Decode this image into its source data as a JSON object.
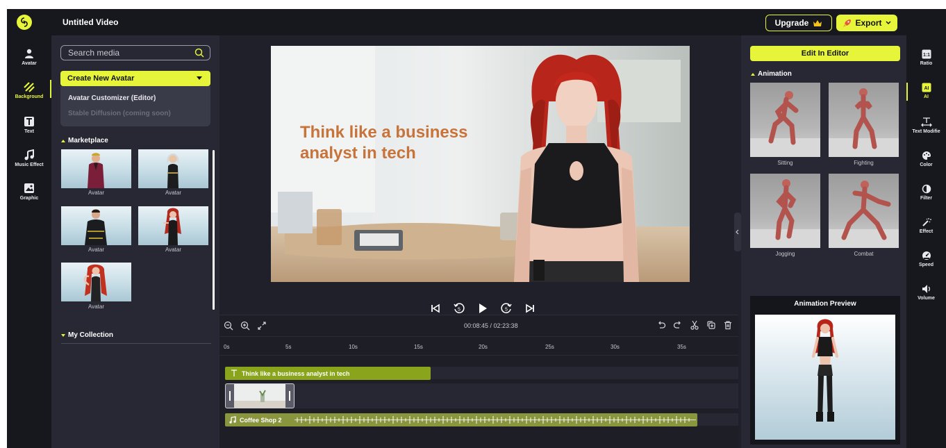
{
  "app": {
    "title": "Untitled Video",
    "upgrade_label": "Upgrade",
    "export_label": "Export",
    "accent_color": "#e6f53a"
  },
  "left_rail": {
    "items": [
      {
        "label": "Avatar",
        "icon": "person-icon"
      },
      {
        "label": "Background",
        "icon": "background-pattern-icon",
        "active": true
      },
      {
        "label": "Text",
        "icon": "text-icon"
      },
      {
        "label": "Music Effect",
        "icon": "music-note-icon"
      },
      {
        "label": "Graphic",
        "icon": "image-icon"
      }
    ]
  },
  "media": {
    "search_placeholder": "Search media",
    "create_button": "Create New Avatar",
    "dropdown": [
      {
        "label": "Avatar Customizer (Editor)",
        "enabled": true
      },
      {
        "label": "Stable Diffusion (coming soon)",
        "enabled": false
      }
    ],
    "marketplace_heading": "Marketplace",
    "marketplace_items": [
      {
        "label": "Avatar"
      },
      {
        "label": "Avatar"
      },
      {
        "label": "Avatar"
      },
      {
        "label": "Avatar"
      },
      {
        "label": "Avatar"
      }
    ],
    "collection_heading": "My Collection"
  },
  "preview": {
    "overlay_text_line1": "Think like a business",
    "overlay_text_line2": "analyst in tech",
    "overlay_color": "#c8733a"
  },
  "timeline": {
    "current_time": "00:08:45",
    "total_time": "02:23:38",
    "time_display": "00:08:45 / 02:23:38",
    "ruler_labels": [
      "0s",
      "5s",
      "10s",
      "15s",
      "20s",
      "25s",
      "30s",
      "35s"
    ],
    "text_clip": "Think like a business analyst in tech",
    "audio_clip": "Coffee Shop 2"
  },
  "right_panel": {
    "edit_button": "Edit In Editor",
    "animation_heading": "Animation",
    "animations": [
      {
        "label": "Sitting"
      },
      {
        "label": "Fighting"
      },
      {
        "label": "Jogging"
      },
      {
        "label": "Combat"
      }
    ],
    "preview_title": "Animation Preview"
  },
  "right_rail": {
    "items": [
      {
        "label": "Ratio",
        "icon": "ratio-icon"
      },
      {
        "label": "AI",
        "icon": "ai-icon",
        "active": true
      },
      {
        "label": "Text Modifie",
        "icon": "text-modifier-icon"
      },
      {
        "label": "Color",
        "icon": "palette-icon"
      },
      {
        "label": "Filter",
        "icon": "filter-icon"
      },
      {
        "label": "Effect",
        "icon": "magic-wand-icon"
      },
      {
        "label": "Speed",
        "icon": "speedometer-icon"
      },
      {
        "label": "Volume",
        "icon": "volume-icon"
      }
    ]
  }
}
